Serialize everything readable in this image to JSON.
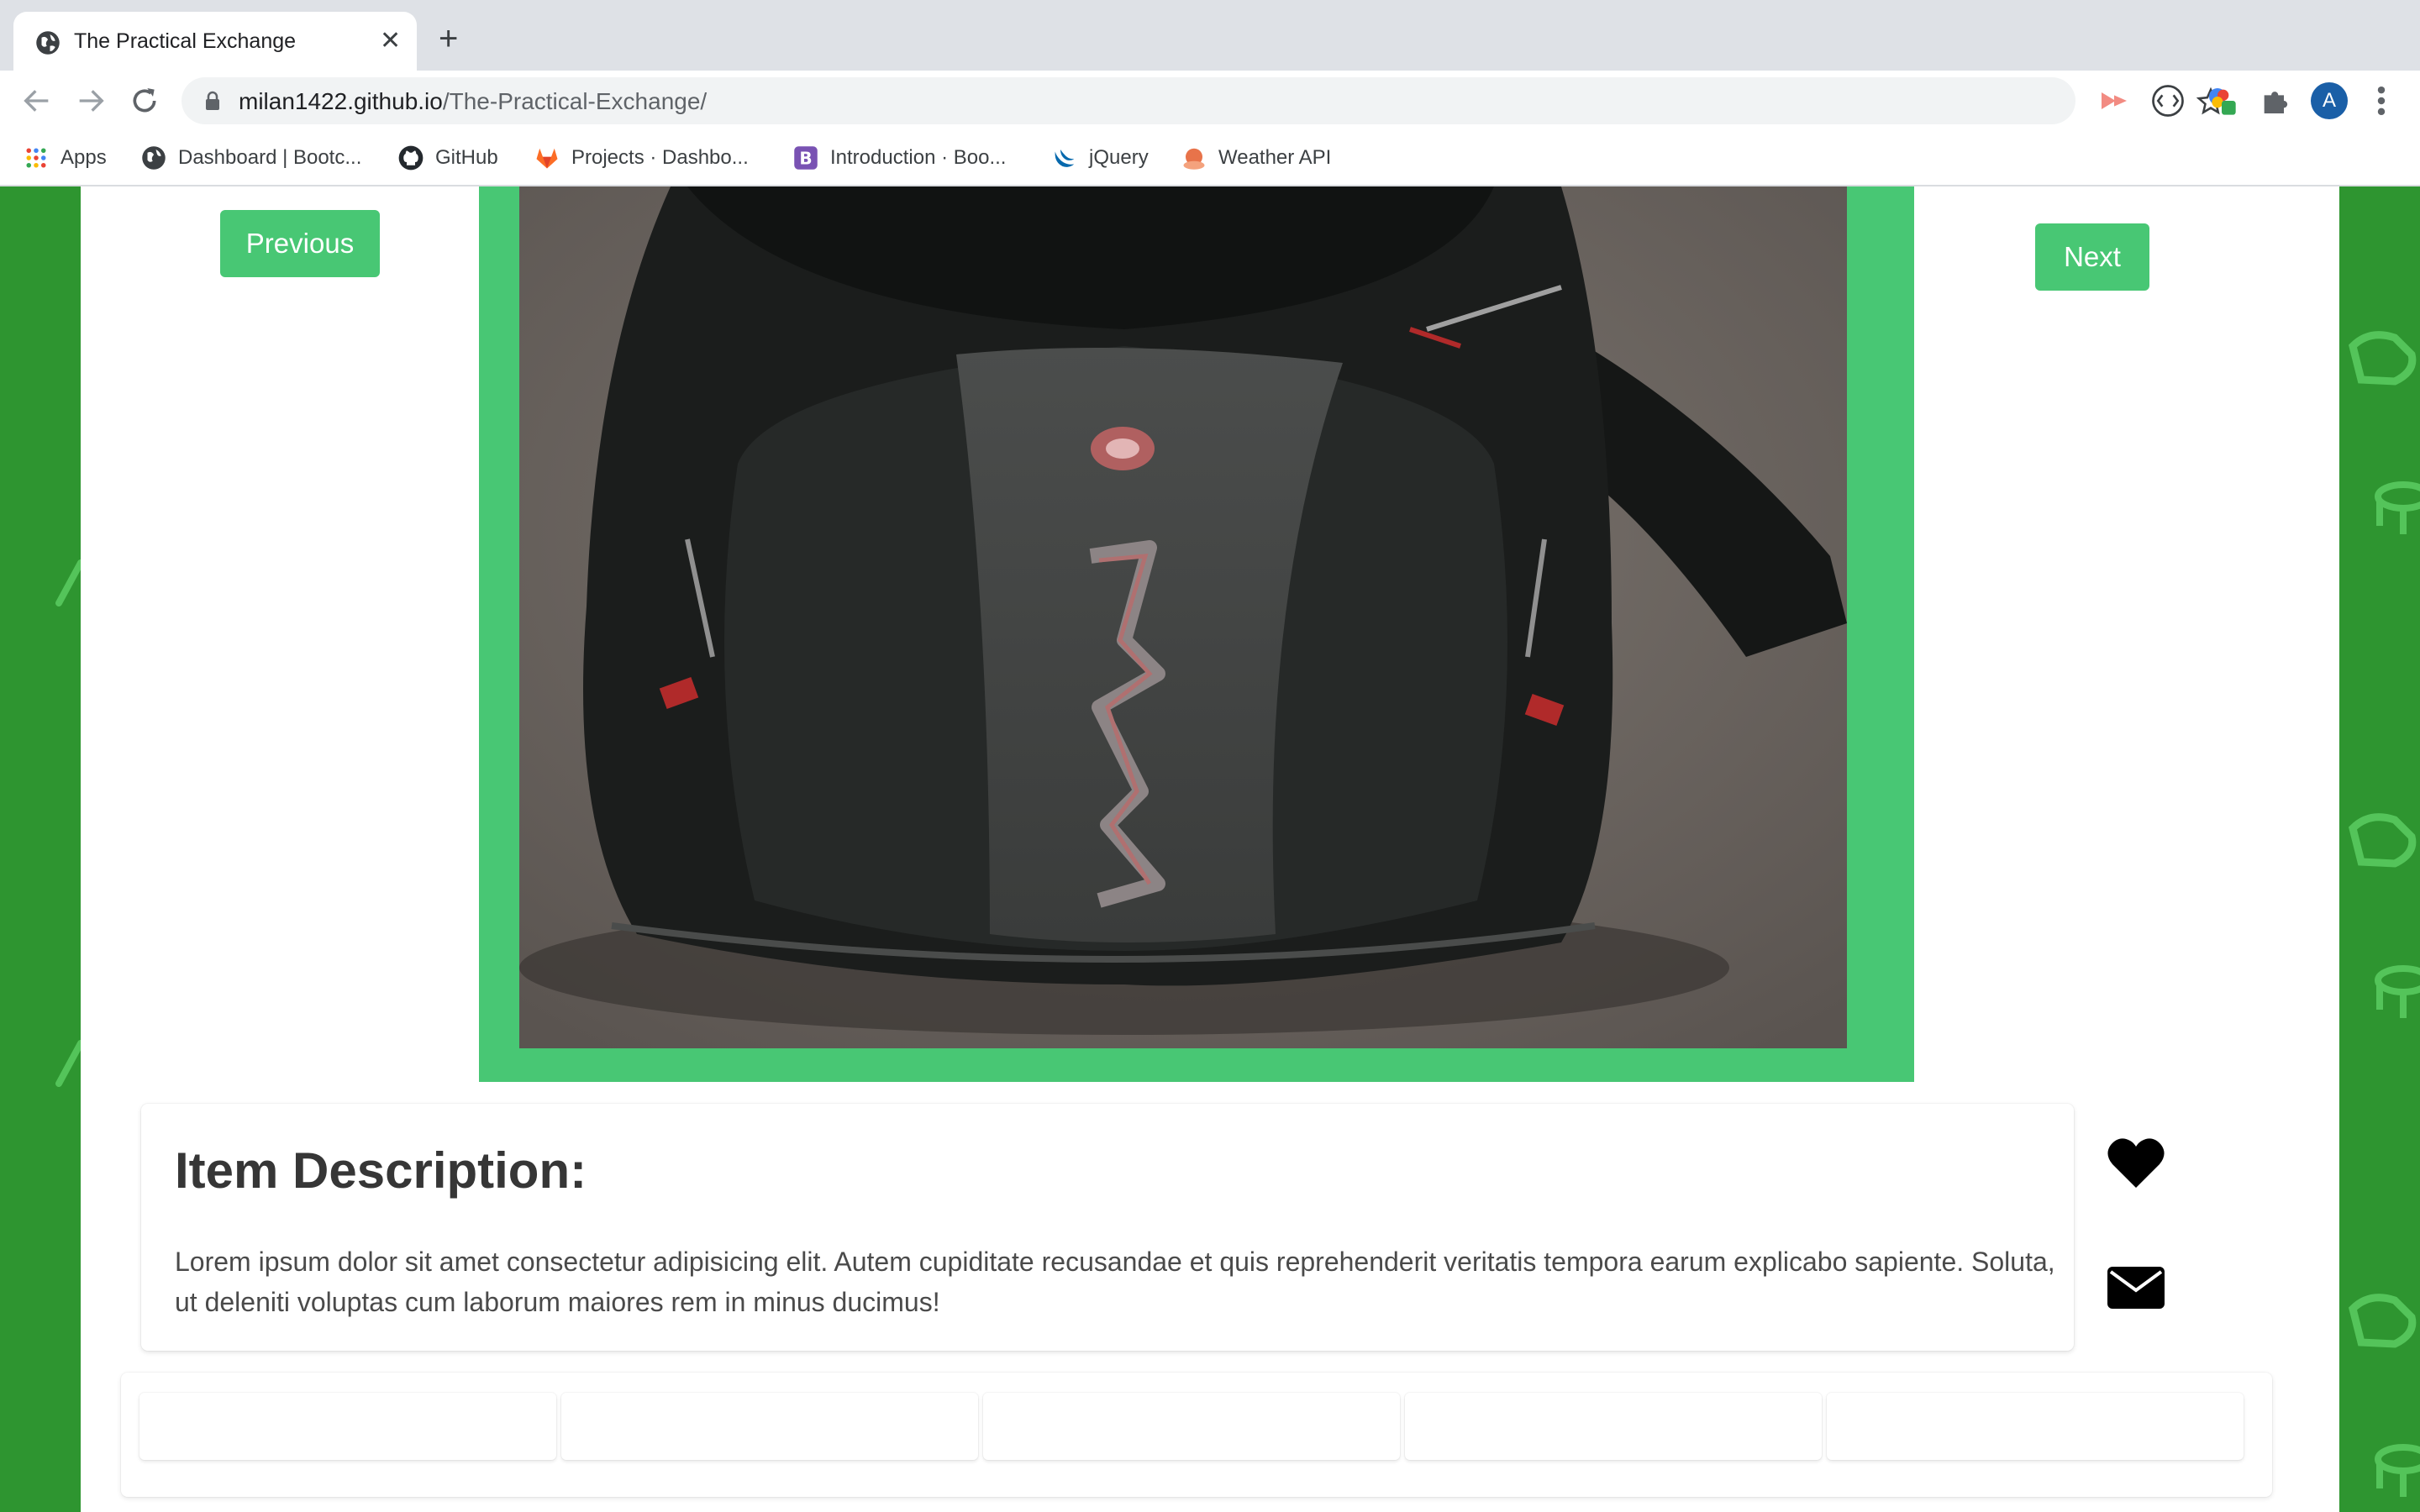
{
  "browser": {
    "tab_title": "The Practical Exchange",
    "url_host": "milan1422.github.io",
    "url_path": "/The-Practical-Exchange/",
    "profile_initial": "A"
  },
  "bookmarks": [
    {
      "label": "Apps",
      "icon": "apps-grid-icon"
    },
    {
      "label": "Dashboard | Bootc...",
      "icon": "globe-icon"
    },
    {
      "label": "GitHub",
      "icon": "github-icon"
    },
    {
      "label": "Projects · Dashbo...",
      "icon": "gitlab-icon"
    },
    {
      "label": "Introduction · Boo...",
      "icon": "bootstrap-icon"
    },
    {
      "label": "jQuery",
      "icon": "jquery-icon"
    },
    {
      "label": "Weather API",
      "icon": "weather-icon"
    }
  ],
  "carousel": {
    "previous_label": "Previous",
    "next_label": "Next"
  },
  "item": {
    "heading": "Item Description:",
    "description": "Lorem ipsum dolor sit amet consectetur adipisicing elit. Autem cupiditate recusandae et quis reprehenderit veritatis tempora earum explicabo sapiente. Soluta, ut deleniti voluptas cum laborum maiores rem in minus ducimus!"
  },
  "actions": {
    "favorite_icon": "heart-icon",
    "message_icon": "envelope-icon"
  },
  "colors": {
    "brand_green": "#48c774",
    "page_background": "#2e9530"
  }
}
